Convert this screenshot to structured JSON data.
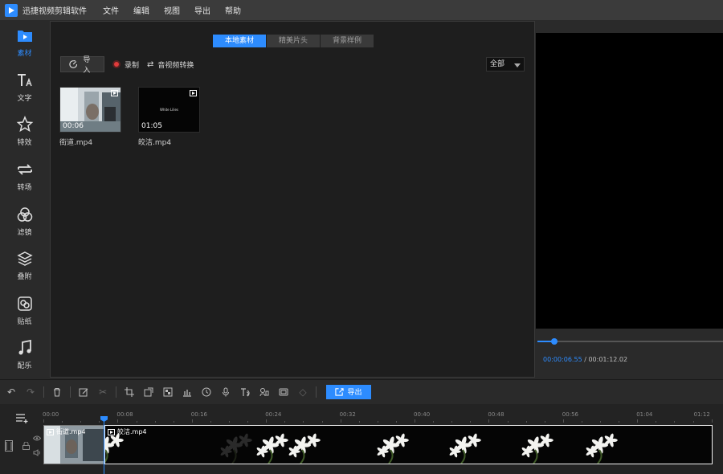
{
  "app": {
    "title": "迅捷视频剪辑软件"
  },
  "menu": [
    "文件",
    "编辑",
    "视图",
    "导出",
    "帮助"
  ],
  "sidebar": {
    "items": [
      {
        "label": "素材",
        "icon": "media-icon",
        "active": true
      },
      {
        "label": "文字",
        "icon": "text-icon"
      },
      {
        "label": "特效",
        "icon": "effects-icon"
      },
      {
        "label": "转场",
        "icon": "transition-icon"
      },
      {
        "label": "滤镜",
        "icon": "filter-icon"
      },
      {
        "label": "叠附",
        "icon": "overlay-icon"
      },
      {
        "label": "贴纸",
        "icon": "sticker-icon"
      },
      {
        "label": "配乐",
        "icon": "music-icon"
      }
    ]
  },
  "media": {
    "tabs": [
      "本地素材",
      "精美片头",
      "背景样例"
    ],
    "active_tab": 0,
    "import_label": "导入",
    "record_label": "录制",
    "convert_label": "音视频转换",
    "filter_value": "全部",
    "items": [
      {
        "name": "街道.mp4",
        "duration": "00:06"
      },
      {
        "name": "皎洁.mp4",
        "duration": "01:05",
        "thumb_text": "White Lilies"
      }
    ]
  },
  "preview": {
    "current_time": "00:00:06.55",
    "total_time": "/ 00:01:12.02",
    "progress": 0.09
  },
  "editbar": {
    "export_label": "导出"
  },
  "timeline": {
    "ticks": [
      "00:00",
      "00:08",
      "00:16",
      "00:24",
      "00:32",
      "00:40",
      "00:48",
      "00:56",
      "01:04",
      "01:12"
    ],
    "clips": [
      {
        "name": "街道.mp4"
      },
      {
        "name": "皎洁.mp4"
      }
    ]
  },
  "colors": {
    "accent": "#2d8cff",
    "panel": "#1e1e1e",
    "background": "#2a2a2a"
  }
}
